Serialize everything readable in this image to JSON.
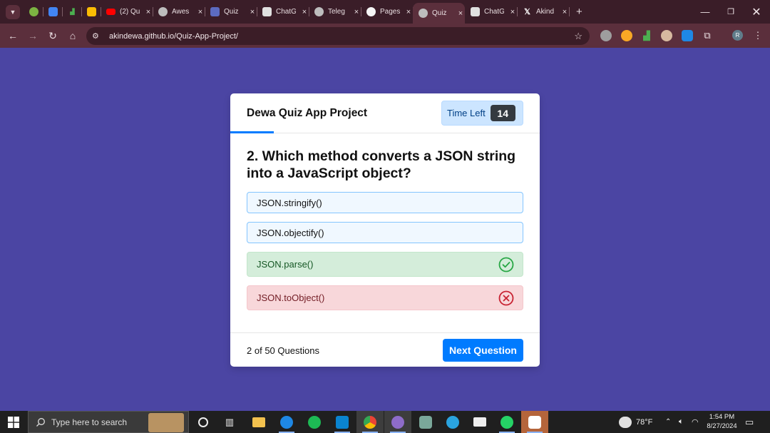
{
  "browser": {
    "tabs": [
      {
        "title": "",
        "color": "#7cb342",
        "active": false
      },
      {
        "title": "",
        "color": "#4285f4",
        "active": false
      },
      {
        "title": "",
        "color": "#4caf50",
        "active": false
      },
      {
        "title": "",
        "color": "#fbbc04",
        "active": false
      },
      {
        "title": "(2) Qu",
        "color": "#ff0000",
        "active": false
      },
      {
        "title": "Awes",
        "color": "#9e9e9e",
        "active": false
      },
      {
        "title": "Quiz",
        "color": "#5c6bc0",
        "active": false
      },
      {
        "title": "ChatG",
        "color": "#e0e0e0",
        "active": false
      },
      {
        "title": "Teleg",
        "color": "#9e9e9e",
        "active": false
      },
      {
        "title": "Pages",
        "color": "#f5f5f5",
        "active": false
      },
      {
        "title": "Quiz",
        "color": "#9e9e9e",
        "active": true
      },
      {
        "title": "ChatG",
        "color": "#e0e0e0",
        "active": false
      },
      {
        "title": "Akind",
        "color": "#000000",
        "active": false
      }
    ],
    "close_glyph": "×",
    "new_tab_glyph": "+",
    "url": "akindewa.github.io/Quiz-App-Project/",
    "profile_initial": "R"
  },
  "quiz": {
    "title": "Dewa Quiz App Project",
    "timer_label": "Time Left",
    "timer_seconds": "14",
    "timer_progress": 0.14,
    "question_text": "2. Which method converts a JSON string into a JavaScript object?",
    "options": [
      {
        "text": "JSON.stringify()",
        "state": "neutral"
      },
      {
        "text": "JSON.objectify()",
        "state": "neutral"
      },
      {
        "text": "JSON.parse()",
        "state": "correct"
      },
      {
        "text": "JSON.toObject()",
        "state": "incorrect"
      }
    ],
    "counter": {
      "current": "2",
      "of_label": "of",
      "total": "50",
      "suffix": "Questions"
    },
    "next_label": "Next Question",
    "colors": {
      "accent": "#007bff",
      "page_bg": "#4b45a3",
      "correct": "#28a745",
      "incorrect": "#c82333"
    }
  },
  "taskbar": {
    "search_placeholder": "Type here to search",
    "weather": "78°F",
    "time": "1:54 PM",
    "date": "8/27/2024"
  }
}
